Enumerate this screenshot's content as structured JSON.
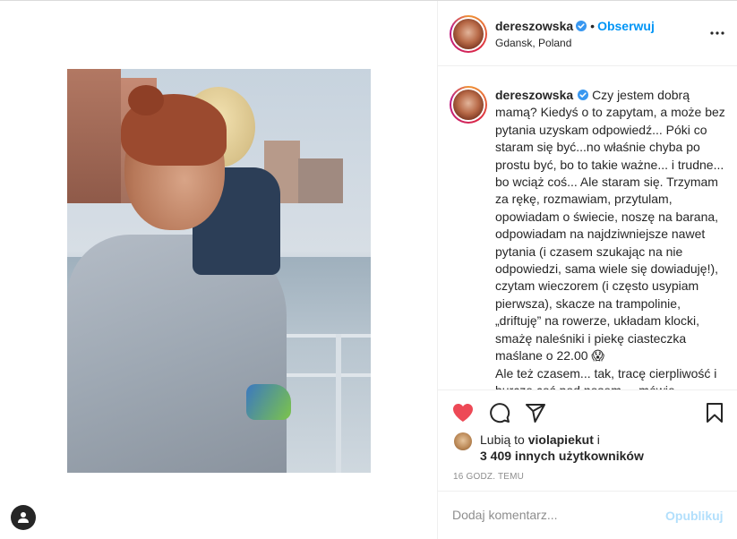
{
  "post": {
    "author": "dereszowska",
    "follow_label": "Obserwuj",
    "separator": "•",
    "location": "Gdansk, Poland",
    "caption_text": "Czy jestem dobrą mamą? Kiedyś o to zapytam, a może bez pytania uzyskam odpowiedź... Póki co staram się być...no właśnie chyba po prostu być, bo to takie ważne... i trudne... bo wciąż coś... Ale staram się. Trzymam za rękę, rozmawiam, przytulam, opowiadam o świecie, noszę na barana, odpowiadam na najdziwniejsze nawet pytania (i czasem szukając na nie odpowiedzi, sama wiele się dowiaduję!), czytam wieczorem (i często usypiam pierwsza), skacze na trampolinie, „driftuję” na rowerze, układam klocki, smażę naleśniki i piekę ciasteczka maślane o 22.00 😱\nAle też czasem... tak, tracę cierpliwość i burczę coś pod nosem ... mówię",
    "likes_prefix": "Lubią to",
    "likes_user": "violapiekut",
    "likes_and": "i",
    "likes_others": "3 409 innych użytkowników",
    "timestamp": "16 GODZ. TEMU",
    "comment_placeholder": "Dodaj komentarz...",
    "post_button": "Opublikuj"
  },
  "icons": {
    "verified": "verified-badge-icon",
    "more": "more-options-icon",
    "like": "heart-filled-icon",
    "comment": "comment-icon",
    "share": "share-icon",
    "save": "bookmark-icon",
    "account": "user-icon"
  },
  "colors": {
    "like": "#ed4956",
    "link": "#0095f6",
    "post_disabled": "#b2dffc"
  }
}
